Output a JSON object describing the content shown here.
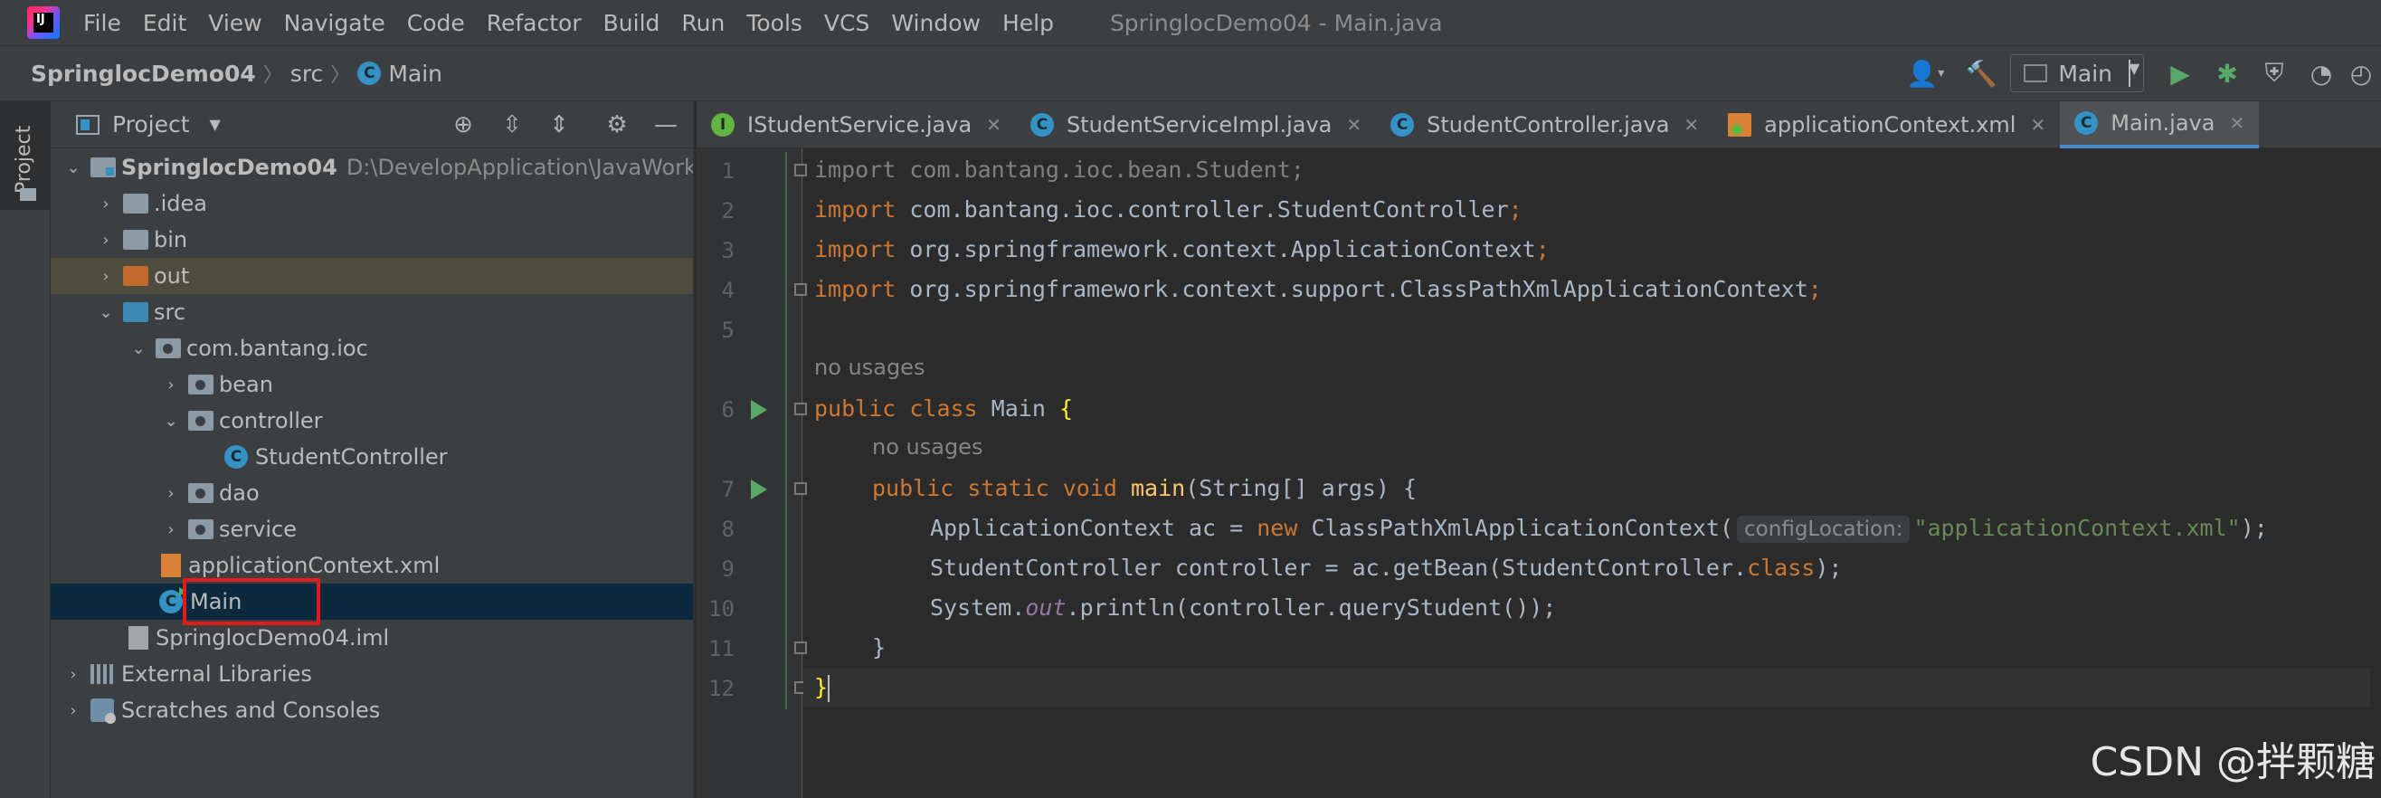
{
  "titlebar": {
    "menu": [
      "File",
      "Edit",
      "View",
      "Navigate",
      "Code",
      "Refactor",
      "Build",
      "Run",
      "Tools",
      "VCS",
      "Window",
      "Help"
    ],
    "window_title": "SpringlocDemo04 - Main.java",
    "logo_text": "IJ"
  },
  "navbar": {
    "project": "SpringlocDemo04",
    "folder": "src",
    "file": "Main",
    "run_config": "Main"
  },
  "toolstrip": {
    "project_tab": "Project"
  },
  "project_panel": {
    "title": "Project",
    "tree": [
      {
        "label": "SpringlocDemo04",
        "path": "D:\\DevelopApplication\\JavaWorkSp"
      },
      {
        "label": ".idea"
      },
      {
        "label": "bin"
      },
      {
        "label": "out"
      },
      {
        "label": "src"
      },
      {
        "label": "com.bantang.ioc"
      },
      {
        "label": "bean"
      },
      {
        "label": "controller"
      },
      {
        "label": "StudentController"
      },
      {
        "label": "dao"
      },
      {
        "label": "service"
      },
      {
        "label": "applicationContext.xml"
      },
      {
        "label": "Main"
      },
      {
        "label": "SpringlocDemo04.iml"
      },
      {
        "label": "External Libraries"
      },
      {
        "label": "Scratches and Consoles"
      }
    ]
  },
  "editor": {
    "tabs": [
      {
        "label": "IStudentService.java",
        "icon": "interface-icon"
      },
      {
        "label": "StudentServiceImpl.java",
        "icon": "class-icon"
      },
      {
        "label": "StudentController.java",
        "icon": "class-icon"
      },
      {
        "label": "applicationContext.xml",
        "icon": "xml-icon"
      },
      {
        "label": "Main.java",
        "icon": "class-icon",
        "active": true
      }
    ],
    "line_numbers": [
      "1",
      "2",
      "3",
      "4",
      "5",
      "6",
      "7",
      "8",
      "9",
      "10",
      "11",
      "12"
    ],
    "usages_hint": "no usages",
    "param_hint": "configLocation:",
    "code": {
      "l1_kw": "import",
      "l1_rest": " com.bantang.ioc.bean.Student;",
      "l2_kw": "import",
      "l2_rest": " com.bantang.ioc.controller.StudentController",
      "l3_kw": "import",
      "l3_rest": " org.springframework.context.ApplicationContext",
      "l4_kw": "import",
      "l4_rest": " org.springframework.context.support.ClassPathXmlApplicationContext",
      "semi": ";",
      "l6_kw": "public class",
      "l6_name": " Main ",
      "l6_brace": "{",
      "l7_kw": "public static void",
      "l7_fn": " main",
      "l7_rest": "(String[] args) {",
      "l8_a": "ApplicationContext ac = ",
      "l8_kw": "new",
      "l8_b": " ClassPathXmlApplicationContext(",
      "l8_str": "\"applicationContext.xml\"",
      "l8_c": ");",
      "l9_a": "StudentController controller = ac.getBean(StudentController.",
      "l9_kw": "class",
      "l9_b": ");",
      "l10_a": "System.",
      "l10_field": "out",
      "l10_b": ".println(controller.queryStudent());",
      "l11": "}",
      "l12": "}"
    }
  },
  "watermark": "CSDN @拌颗糖",
  "colors": {
    "keyword": "#cc7832",
    "string": "#6a8759",
    "function": "#ffc66d",
    "field": "#9876aa",
    "accent": "#4a88c7"
  }
}
